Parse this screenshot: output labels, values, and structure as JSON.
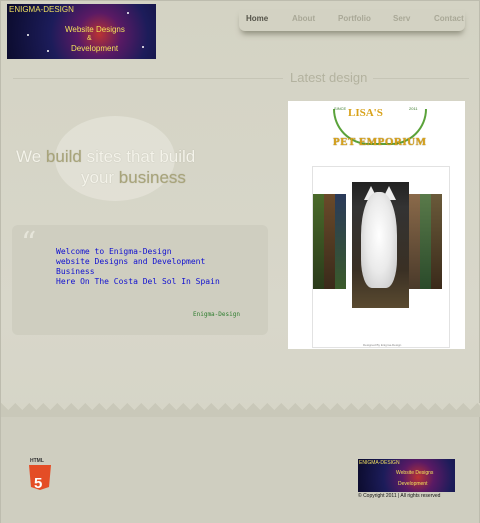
{
  "logo": {
    "name": "ENIGMA-DESIGN",
    "line1": "Website Designs",
    "line2": "&",
    "line3": "Development"
  },
  "nav": {
    "items": [
      {
        "label": "Home",
        "active": true
      },
      {
        "label": "About",
        "active": false
      },
      {
        "label": "Portfolio",
        "active": false
      },
      {
        "label": "Serv",
        "active": false
      },
      {
        "label": "Contact",
        "active": false
      }
    ]
  },
  "latest": {
    "title": "Latest design"
  },
  "tagline": {
    "w1": "We ",
    "w2": "build",
    "w3": " sites that build",
    "w4": "your ",
    "w5": "business"
  },
  "quote": {
    "mark": "“",
    "text": "Welcome to Enigma-Design\nwebsite Designs and Development\nBusiness\nHere On The Costa Del Sol In Spain",
    "signature": "Enigma-Design"
  },
  "preview": {
    "badge_left": "SINCE",
    "badge_right": "2011",
    "title1": "LISA'S",
    "title2": "PET EMPORIUM",
    "footer": "Designed By Enigma-Design"
  },
  "footer": {
    "html5_label": "HTML",
    "html5_number": "5",
    "logo_name": "ENIGMA-DESIGN",
    "logo_line1": "Website Designs",
    "logo_line2": "Development",
    "copyright": "© Copyright 2011 | All rights reserved"
  },
  "colors": {
    "background": "#d7d6c8",
    "quote_text": "#1010d0",
    "signature": "#2e7d2e",
    "html5": "#e44d26"
  }
}
